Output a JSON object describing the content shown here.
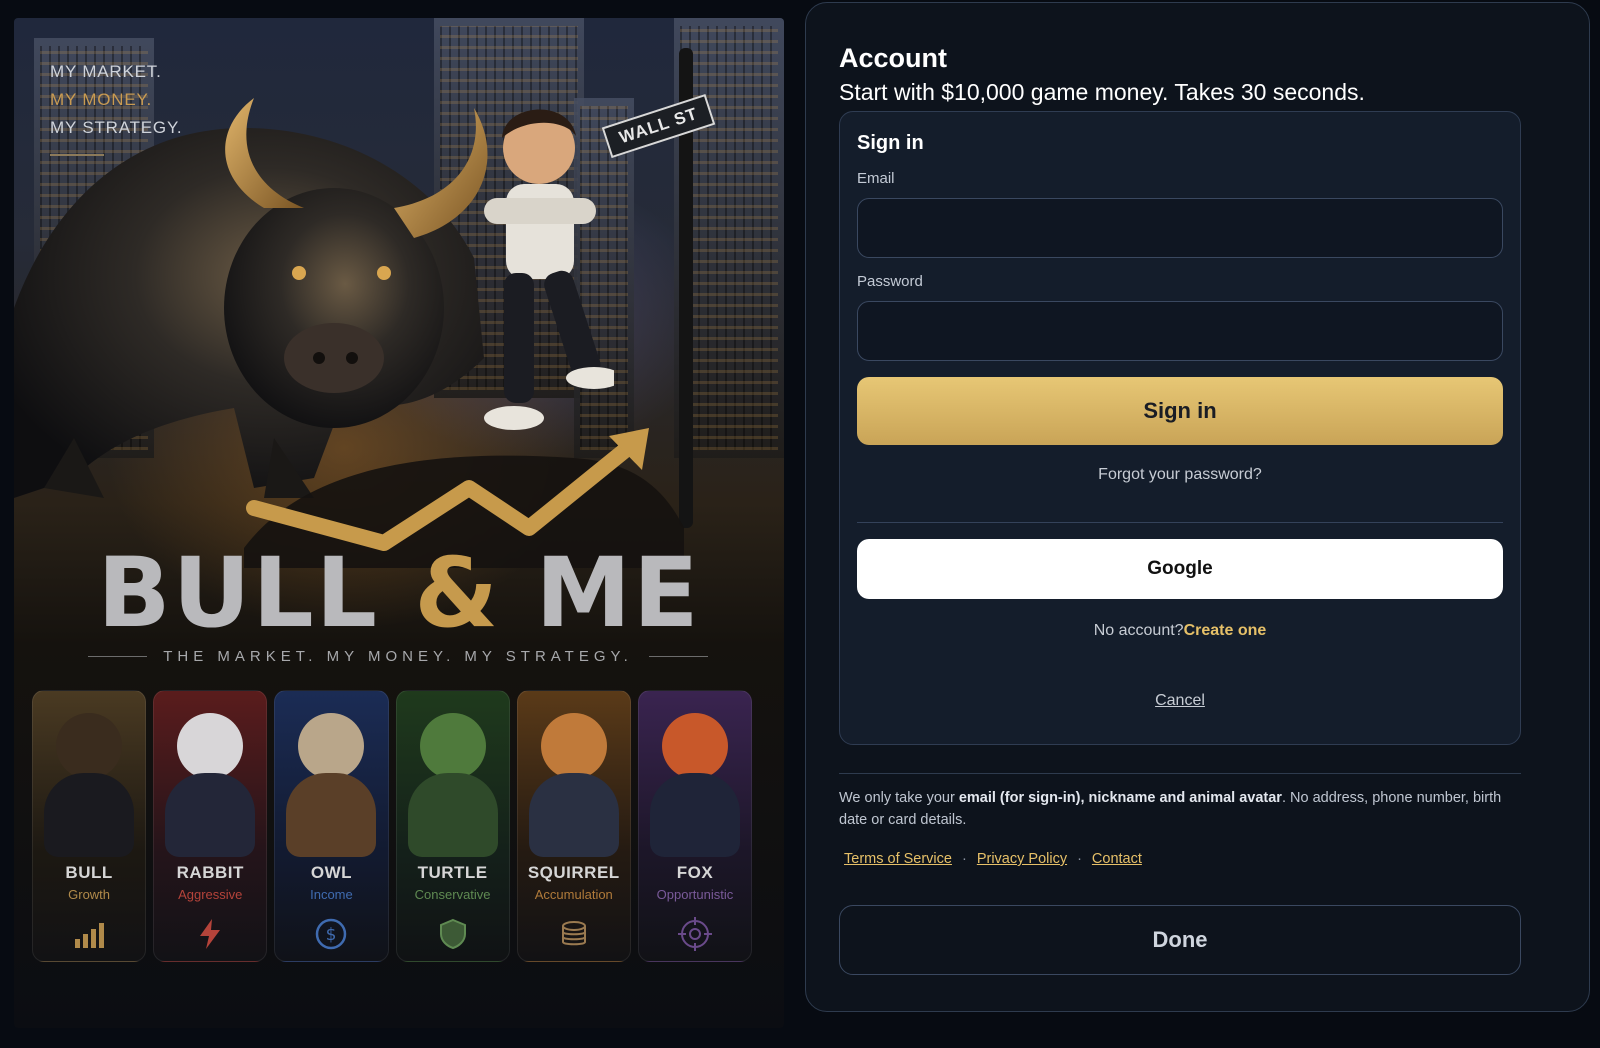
{
  "poster": {
    "tagline_line1": "MY MARKET.",
    "tagline_line2": "MY MONEY.",
    "tagline_line3": "MY STRATEGY.",
    "street_sign": "WALL ST",
    "logo_left": "BULL",
    "logo_amp": "&",
    "logo_right": "ME",
    "logo_subtitle": "THE MARKET. MY MONEY. MY STRATEGY.",
    "accent_color": "#c69a4d",
    "animals": [
      {
        "name": "BULL",
        "type": "Growth",
        "icon": "bar-chart-icon",
        "type_color": "#b08a4a"
      },
      {
        "name": "RABBIT",
        "type": "Aggressive",
        "icon": "lightning-icon",
        "type_color": "#b5433a"
      },
      {
        "name": "OWL",
        "type": "Income",
        "icon": "dollar-coin-icon",
        "type_color": "#3f6bb0"
      },
      {
        "name": "TURTLE",
        "type": "Conservative",
        "icon": "shield-icon",
        "type_color": "#5f8a52"
      },
      {
        "name": "SQUIRREL",
        "type": "Accumulation",
        "icon": "coin-stack-icon",
        "type_color": "#b07a3a"
      },
      {
        "name": "FOX",
        "type": "Opportunistic",
        "icon": "target-icon",
        "type_color": "#7a5a9a"
      }
    ]
  },
  "account": {
    "title": "Account",
    "subtitle": "Start with $10,000 game money. Takes 30 seconds.",
    "signin_card": {
      "title": "Sign in",
      "email_label": "Email",
      "email_value": "",
      "password_label": "Password",
      "password_value": "",
      "signin_button": "Sign in",
      "forgot_link": "Forgot your password?",
      "google_button": "Google",
      "no_account_text": "No account?",
      "create_link": "Create one",
      "cancel_link": "Cancel"
    },
    "privacy": {
      "prefix": "We only take your ",
      "bold": "email (for sign-in), nickname and animal avatar",
      "suffix": ". No address, phone number, birth date or card details."
    },
    "links": {
      "terms": "Terms of Service",
      "privacy": "Privacy Policy",
      "contact": "Contact",
      "separator": "·"
    },
    "done_button": "Done"
  }
}
